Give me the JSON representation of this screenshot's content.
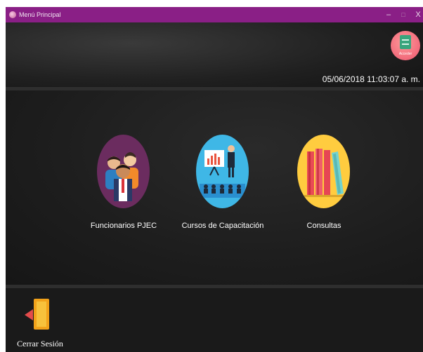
{
  "window": {
    "title": "Menú Principal",
    "controls": {
      "minimize": "–",
      "maximize": "□",
      "close": "X"
    }
  },
  "header": {
    "settings_button": {
      "label": "Acceder",
      "icon": "checklist-icon"
    },
    "datetime": "05/06/2018 11:03:07 a. m."
  },
  "menu": {
    "items": [
      {
        "label": "Funcionarios PJEC",
        "icon": "people-icon",
        "circle_color": "#6b2c5f"
      },
      {
        "label": "Cursos de Capacitación",
        "icon": "presentation-icon",
        "circle_color": "#3fb7e6"
      },
      {
        "label": "Consultas",
        "icon": "books-icon",
        "circle_color": "#ffcc3f"
      }
    ]
  },
  "footer": {
    "logout": {
      "label": "Cerrar Sesión",
      "icon": "logout-door-icon"
    }
  },
  "colors": {
    "titlebar": "#8a1f86",
    "background": "#1c1c1c",
    "settings_button": "#f26a7b"
  }
}
